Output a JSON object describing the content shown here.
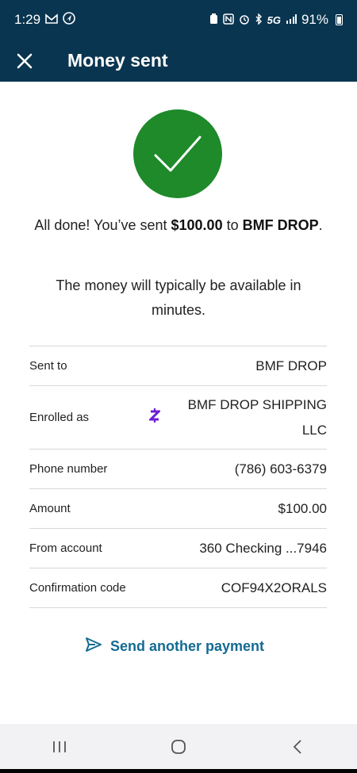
{
  "status_bar": {
    "time": "1:29",
    "network": "5G",
    "battery": "91%",
    "icons": [
      "gmail-icon",
      "navigation-icon",
      "nfc-icon",
      "alarm-icon",
      "bluetooth-icon",
      "signal-icon",
      "battery-icon"
    ]
  },
  "header": {
    "title": "Money sent",
    "close_icon": "close-icon"
  },
  "confirmation": {
    "icon": "checkmark-icon",
    "color": "#1e8a2a",
    "msg_prefix": "All done! You’ve sent ",
    "amount": "$100.00",
    "msg_mid": " to ",
    "recipient": "BMF DROP",
    "msg_suffix": ".",
    "availability": "The money will typically be available in minutes."
  },
  "details": [
    {
      "label": "Sent to",
      "value": "BMF DROP"
    },
    {
      "label": "Enrolled as",
      "value": "BMF DROP SHIPPING LLC",
      "icon": "zelle-icon"
    },
    {
      "label": "Phone number",
      "value": "(786) 603-6379"
    },
    {
      "label": "Amount",
      "value": "$100.00"
    },
    {
      "label": "From account",
      "value": "360 Checking ...7946"
    },
    {
      "label": "Confirmation code",
      "value": "COF94X2ORALS"
    }
  ],
  "actions": {
    "send_another": "Send another payment",
    "accent": "#136b92"
  },
  "nav": [
    "recent-apps-icon",
    "home-icon",
    "back-icon"
  ],
  "colors": {
    "header": "#0a3550",
    "zelle": "#6d1ed4"
  }
}
